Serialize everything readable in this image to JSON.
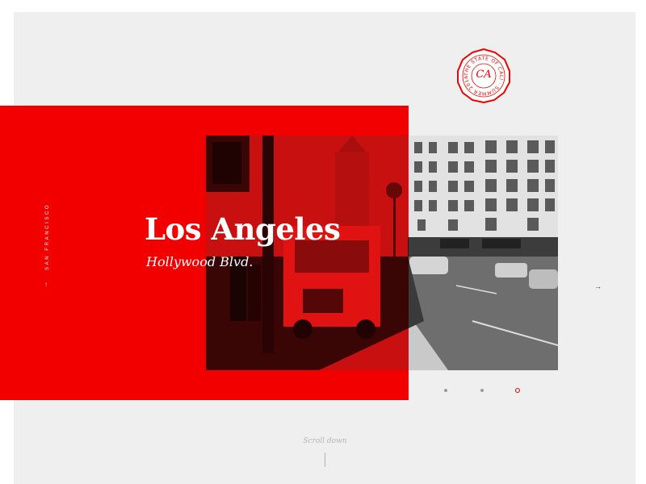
{
  "hero": {
    "title": "Los Angeles",
    "subtitle": "Hollywood Blvd."
  },
  "nav": {
    "prev_city": "SAN FRANCISCO",
    "prev_arrow": "←",
    "next_arrow": "→"
  },
  "badge": {
    "monogram": "CA",
    "ring_text": "THE STATE OF CALI · SUMMER 2016 ·"
  },
  "slider": {
    "count": 3,
    "active_index": 2
  },
  "scroll": {
    "label": "Scroll down"
  },
  "colors": {
    "accent": "#f20000",
    "panel_bg": "#efefef",
    "muted": "#9a9a9a"
  }
}
